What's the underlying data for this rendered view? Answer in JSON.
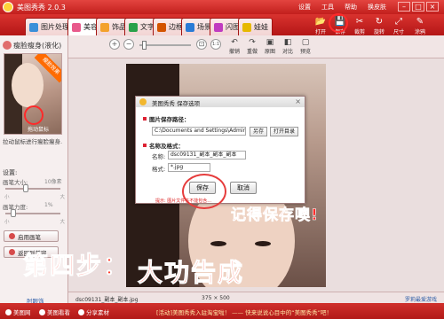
{
  "titlebar": {
    "title": "美图秀秀 2.0.3",
    "menu": [
      "设置",
      "工具",
      "帮助",
      "换皮肤"
    ],
    "min": "–",
    "max": "□",
    "close": "×"
  },
  "tabs": [
    {
      "label": "图片处理",
      "icon": "photo-edit-icon",
      "color": "#3a8fd9"
    },
    {
      "label": "美容",
      "icon": "beauty-icon",
      "color": "#e85a8c"
    },
    {
      "label": "饰品",
      "icon": "accessory-icon",
      "color": "#f3a12b"
    },
    {
      "label": "文字",
      "icon": "text-icon",
      "color": "#2aa14a"
    },
    {
      "label": "边框",
      "icon": "frame-icon",
      "color": "#d35400"
    },
    {
      "label": "场景",
      "icon": "scene-icon",
      "color": "#2a7bd6"
    },
    {
      "label": "闪图",
      "icon": "flash-icon",
      "color": "#c03bc0"
    },
    {
      "label": "娃娃",
      "icon": "doll-icon",
      "color": "#e6b800"
    }
  ],
  "right_tools": [
    {
      "label": "打开",
      "icon": "folder-icon",
      "glyph": "📂"
    },
    {
      "label": "保存",
      "icon": "save-icon",
      "glyph": "💾"
    },
    {
      "label": "裁剪",
      "icon": "crop-icon",
      "glyph": "✂"
    },
    {
      "label": "旋转",
      "icon": "rotate-icon",
      "glyph": "↻"
    },
    {
      "label": "尺寸",
      "icon": "resize-icon",
      "glyph": "⤢"
    },
    {
      "label": "涂鸦",
      "icon": "brush-icon",
      "glyph": "✎"
    }
  ],
  "left_panel": {
    "title": "瘦脸瘦身(液化)",
    "thumb_ribbon": "瘦脸效果",
    "thumb_caption": "拖动鼠标",
    "description": "拉动鼠标进行瘦脸瘦身.",
    "settings_label": "设置:",
    "brush_size_label": "画笔大小:",
    "brush_size_value": "10像素",
    "brush_strength_label": "画笔力度:",
    "brush_strength_value": "1%",
    "brush_size_fraction": 0.35,
    "brush_strength_fraction": 0.1,
    "ticks_small": "小",
    "ticks_large": "大",
    "btn_enable": "启用画笔",
    "btn_back": "返回到美容",
    "footer": "肘眼饰"
  },
  "subtool": {
    "zoom_in": "+",
    "zoom_out": "−",
    "fit": "⊡",
    "actual": "1:1",
    "zoom_fraction": 0.05,
    "actions": [
      {
        "label": "撤销",
        "icon": "undo-icon",
        "glyph": "↶"
      },
      {
        "label": "重做",
        "icon": "redo-icon",
        "glyph": "↷"
      },
      {
        "label": "原图",
        "icon": "original-icon",
        "glyph": "▣"
      },
      {
        "label": "对比",
        "icon": "compare-icon",
        "glyph": "◧"
      },
      {
        "label": "预览",
        "icon": "preview-icon",
        "glyph": "▢"
      }
    ]
  },
  "dialog": {
    "title": "美图秀秀 保存选项",
    "path_heading": "图片保存路径：",
    "path_value": "C:\\Documents and Settings\\Admin",
    "btn_browse": "另存",
    "btn_open_folder": "打开目录",
    "name_heading": "名称及格式：",
    "name_label": "名称:",
    "name_value": "dsc09131_副本_副本_副本",
    "format_label": "格式:",
    "format_value": "*.jpg",
    "btn_save": "保存",
    "btn_cancel": "取消",
    "note": "提示: 图片文件名不能包含..."
  },
  "annotations": {
    "remember": "记得保存噢!",
    "step_a": "第四步：",
    "step_b": "大功告成"
  },
  "statusbar": {
    "filename": "dsc09131_副本_副本.jpg",
    "dims": "375 × 500",
    "promo": "罗莉最爱游戏"
  },
  "bottombar": {
    "items": [
      "美图网",
      "美图看看",
      "分享素材"
    ],
    "news": "[活动]美图秀秀入驻淘宝啦！ —— 快来说说心目中的“美图秀秀”吧！"
  },
  "colors": {
    "brand_red": "#c92420",
    "annotation_red": "#ff2b2b"
  }
}
